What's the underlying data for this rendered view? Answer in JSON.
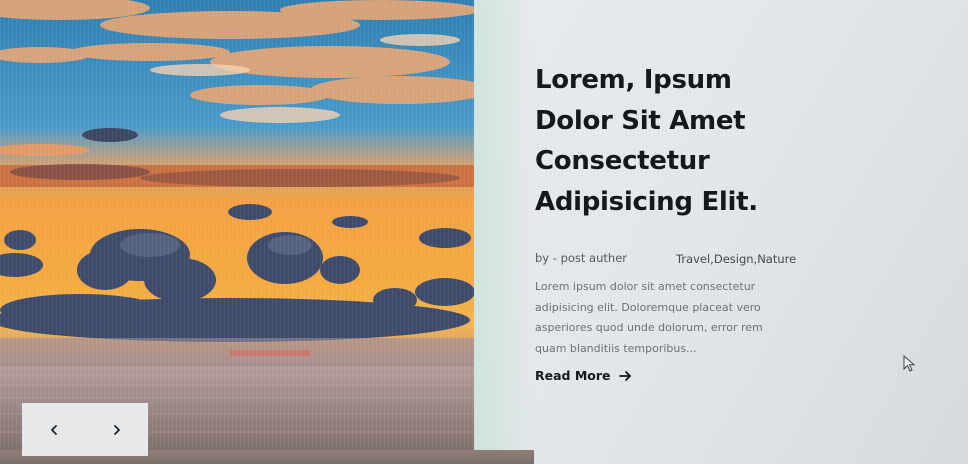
{
  "post": {
    "title_lines": [
      "Lorem, Ipsum",
      "Dolor Sit Amet",
      "Consectetur",
      "Adipisicing Elit."
    ],
    "author": "by - post auther",
    "tags": "Travel,Design,Nature",
    "excerpt_lines": [
      "Lorem ipsum dolor sit amet consectetur",
      "adipisicing elit. Doloremque placeat vero",
      "asperiores quod unde dolorum, error rem",
      "quam blanditiis temporibus..."
    ],
    "read_more_label": "Read More"
  },
  "slider": {
    "prev_icon": "chevron-left-icon",
    "next_icon": "chevron-right-icon"
  },
  "colors": {
    "title": "#15191c",
    "text": "#6b7175",
    "panel": "#e6e9eb"
  }
}
